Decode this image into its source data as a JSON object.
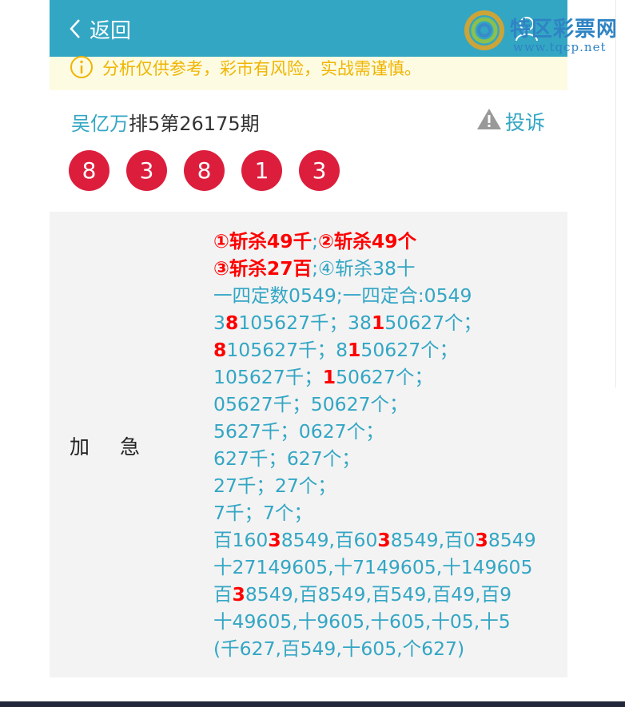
{
  "header": {
    "back_label": "返回",
    "bg_color": "#33a6c4"
  },
  "watermark": {
    "name": "特区彩票网",
    "url": "www.tqcp.net"
  },
  "notice": {
    "text": "分析仅供参考，彩市有风险，实战需谨慎。",
    "color": "#f0b400"
  },
  "article": {
    "author": "吴亿万",
    "title": "排5第26175期",
    "complain_label": "投诉"
  },
  "balls": [
    "8",
    "3",
    "8",
    "1",
    "3"
  ],
  "panel": {
    "label_a": "加",
    "label_b": "急",
    "lines": [
      [
        {
          "t": "①斩杀49千",
          "r": true
        },
        {
          "t": ";",
          "r": false
        },
        {
          "t": "②斩杀49个",
          "r": true
        }
      ],
      [
        {
          "t": "③斩杀27百",
          "r": true
        },
        {
          "t": ";④斩杀38十",
          "r": false
        }
      ],
      [
        {
          "t": "一四定数0549;一四定合:0549",
          "r": false
        }
      ],
      [
        {
          "t": "3",
          "r": false
        },
        {
          "t": "8",
          "r": true
        },
        {
          "t": "105627千；38",
          "r": false
        },
        {
          "t": "1",
          "r": true
        },
        {
          "t": "50627个；",
          "r": false
        }
      ],
      [
        {
          "t": "8",
          "r": true
        },
        {
          "t": "105627千；8",
          "r": false
        },
        {
          "t": "1",
          "r": true
        },
        {
          "t": "50627个；",
          "r": false
        }
      ],
      [
        {
          "t": "105627千；",
          "r": false
        },
        {
          "t": "1",
          "r": true
        },
        {
          "t": "50627个；",
          "r": false
        }
      ],
      [
        {
          "t": "05627千；50627个；",
          "r": false
        }
      ],
      [
        {
          "t": "5627千；0627个；",
          "r": false
        }
      ],
      [
        {
          "t": "627千；627个；",
          "r": false
        }
      ],
      [
        {
          "t": "27千；27个；",
          "r": false
        }
      ],
      [
        {
          "t": "7千；7个；",
          "r": false
        }
      ],
      [
        {
          "t": "百160",
          "r": false
        },
        {
          "t": "3",
          "r": true
        },
        {
          "t": "8549,百60",
          "r": false
        },
        {
          "t": "3",
          "r": true
        },
        {
          "t": "8549,百0",
          "r": false
        },
        {
          "t": "3",
          "r": true
        },
        {
          "t": "8549",
          "r": false
        }
      ],
      [
        {
          "t": "十27149605,十7149605,十149605",
          "r": false
        }
      ],
      [
        {
          "t": "百",
          "r": false
        },
        {
          "t": "3",
          "r": true
        },
        {
          "t": "8549,百8549,百549,百49,百9",
          "r": false
        }
      ],
      [
        {
          "t": "十49605,十9605,十605,十05,十5",
          "r": false
        }
      ],
      [
        {
          "t": "(千627,百549,十605,个627)",
          "r": false
        }
      ]
    ]
  },
  "colors": {
    "accent": "#33a6c4",
    "ball": "#dc1e3c",
    "highlight": "#ff0000"
  }
}
